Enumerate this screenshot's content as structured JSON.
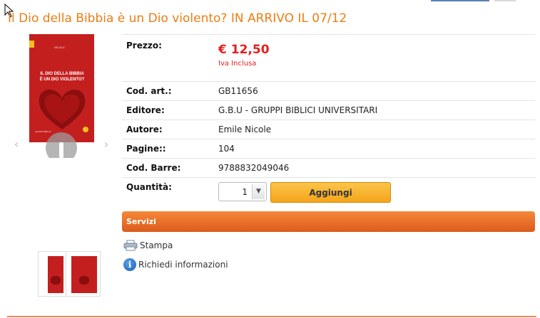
{
  "product": {
    "title": "Il Dio della Bibbia è un Dio violento? IN ARRIVO IL 07/12",
    "cover": {
      "brand": "NICOLE",
      "title_line1": "IL DIO DELLA BIBBIA",
      "title_line2": "È UN DIO VIOLENTO?",
      "footer": "GRUPPI BIBLICI"
    }
  },
  "gallery": {
    "prev_glyph": "‹",
    "next_glyph": "›",
    "zoom_icon": "magnifier-icon"
  },
  "details": {
    "price_label": "Prezzo:",
    "price_value": "€ 12,50",
    "vat_note": "Iva Inclusa",
    "rows": [
      {
        "label": "Cod. art.:",
        "value": "GB11656"
      },
      {
        "label": "Editore:",
        "value": "G.B.U - GRUPPI BIBLICI UNIVERSITARI"
      },
      {
        "label": "Autore:",
        "value": "Emile Nicole"
      },
      {
        "label": "Pagine::",
        "value": "104"
      },
      {
        "label": "Cod. Barre:",
        "value": "9788832049046"
      }
    ],
    "quantity_label": "Quantità:",
    "quantity_value": "1",
    "add_button": "Aggiungi"
  },
  "services": {
    "header": "Servizi",
    "print_label": "Stampa",
    "info_label": "Richiedi informazioni",
    "print_icon": "printer-icon",
    "info_icon": "info-icon"
  },
  "colors": {
    "title": "#ec7d13",
    "price": "#e02020",
    "services_bar": "#e8692a",
    "add_button": "#f7b233"
  }
}
